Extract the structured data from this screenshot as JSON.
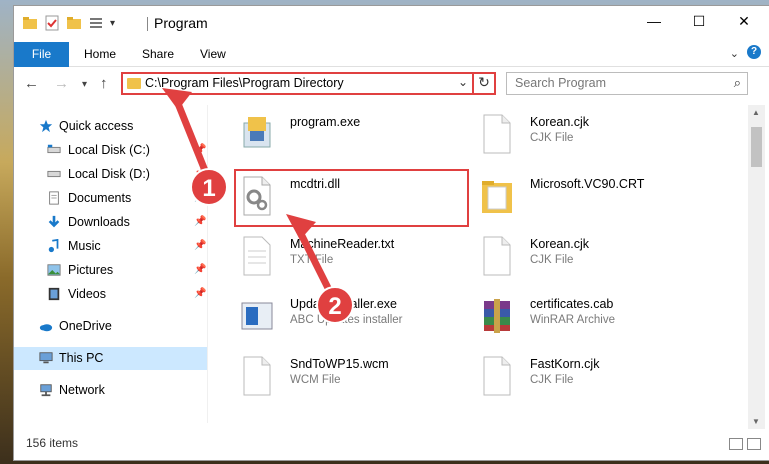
{
  "window": {
    "title": "Program"
  },
  "window_controls": {
    "minimize": "—",
    "maximize": "☐",
    "close": "✕"
  },
  "ribbon": {
    "tabs": [
      "File",
      "Home",
      "Share",
      "View"
    ],
    "help": "?"
  },
  "nav": {
    "back": "←",
    "forward": "→",
    "recent": "▾",
    "up": "↑",
    "address": "C:\\Program Files\\Program Directory",
    "search_placeholder": "Search Program"
  },
  "sidebar": {
    "items": [
      {
        "label": "Quick access",
        "icon": "star-icon",
        "pinned": false
      },
      {
        "label": "Local Disk (C:)",
        "icon": "drive-icon",
        "pinned": true
      },
      {
        "label": "Local Disk (D:)",
        "icon": "drive-icon",
        "pinned": true
      },
      {
        "label": "Documents",
        "icon": "documents-icon",
        "pinned": true
      },
      {
        "label": "Downloads",
        "icon": "downloads-icon",
        "pinned": true
      },
      {
        "label": "Music",
        "icon": "music-icon",
        "pinned": true
      },
      {
        "label": "Pictures",
        "icon": "pictures-icon",
        "pinned": true
      },
      {
        "label": "Videos",
        "icon": "videos-icon",
        "pinned": true
      },
      {
        "label": "OneDrive",
        "icon": "onedrive-icon",
        "pinned": false
      },
      {
        "label": "This PC",
        "icon": "pc-icon",
        "pinned": false
      },
      {
        "label": "Network",
        "icon": "network-icon",
        "pinned": false
      }
    ]
  },
  "files": [
    {
      "name": "program.exe",
      "type": "",
      "icon": "exe-icon"
    },
    {
      "name": "Korean.cjk",
      "type": "CJK File",
      "icon": "blank-file-icon"
    },
    {
      "name": "mcdtri.dll",
      "type": "",
      "icon": "dll-icon"
    },
    {
      "name": "Microsoft.VC90.CRT",
      "type": "",
      "icon": "folder-icon"
    },
    {
      "name": "MachineReader.txt",
      "type": "TXT File",
      "icon": "txt-icon"
    },
    {
      "name": "Korean.cjk",
      "type": "CJK File",
      "icon": "blank-file-icon"
    },
    {
      "name": "UpdateInstaller.exe",
      "type": "ABC Updates installer",
      "icon": "installer-icon"
    },
    {
      "name": "certificates.cab",
      "type": "WinRAR Archive",
      "icon": "rar-icon"
    },
    {
      "name": "SndToWP15.wcm",
      "type": "WCM File",
      "icon": "blank-file-icon"
    },
    {
      "name": "FastKorn.cjk",
      "type": "CJK File",
      "icon": "blank-file-icon"
    }
  ],
  "status": {
    "count": "156 items"
  },
  "annotations": {
    "step1": "1",
    "step2": "2"
  },
  "colors": {
    "accent": "#1979ca",
    "highlight": "#e04040",
    "selected": "#cce8ff",
    "folder": "#f0c24a"
  }
}
